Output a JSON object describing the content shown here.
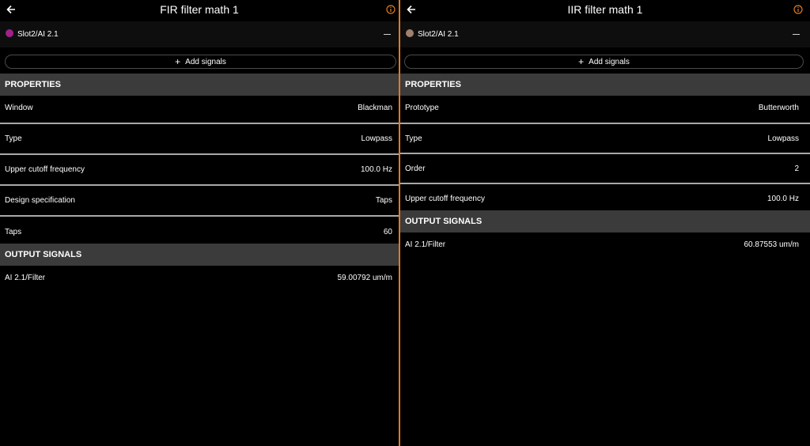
{
  "fir": {
    "title": "FIR filter math 1",
    "signal": {
      "name": "Slot2/AI 2.1",
      "color": "#a0208c"
    },
    "add_signals_label": "Add signals",
    "properties_header": "PROPERTIES",
    "properties": [
      {
        "label": "Window",
        "value": "Blackman"
      },
      {
        "label": "Type",
        "value": "Lowpass"
      },
      {
        "label": "Upper cutoff frequency",
        "value": "100.0 Hz"
      },
      {
        "label": "Design specification",
        "value": "Taps"
      },
      {
        "label": "Taps",
        "value": "60"
      }
    ],
    "output_header": "OUTPUT SIGNALS",
    "outputs": [
      {
        "label": "AI 2.1/Filter",
        "value": "59.00792 um/m"
      }
    ]
  },
  "iir": {
    "title": "IIR filter math 1",
    "signal": {
      "name": "Slot2/AI 2.1",
      "color": "#a0806e"
    },
    "add_signals_label": "Add signals",
    "properties_header": "PROPERTIES",
    "properties": [
      {
        "label": "Prototype",
        "value": "Butterworth"
      },
      {
        "label": "Type",
        "value": "Lowpass"
      },
      {
        "label": "Order",
        "value": "2"
      },
      {
        "label": "Upper cutoff frequency",
        "value": "100.0 Hz"
      }
    ],
    "output_header": "OUTPUT SIGNALS",
    "outputs": [
      {
        "label": "AI 2.1/Filter",
        "value": "60.87553 um/m"
      }
    ]
  },
  "colors": {
    "accent": "#e07a22",
    "section_bg": "#3b3b3b",
    "separator": "#a8a8a8"
  },
  "icons": {
    "back": "arrow-left-icon",
    "info": "info-circle-icon",
    "remove": "minus-icon",
    "add": "plus-icon"
  }
}
